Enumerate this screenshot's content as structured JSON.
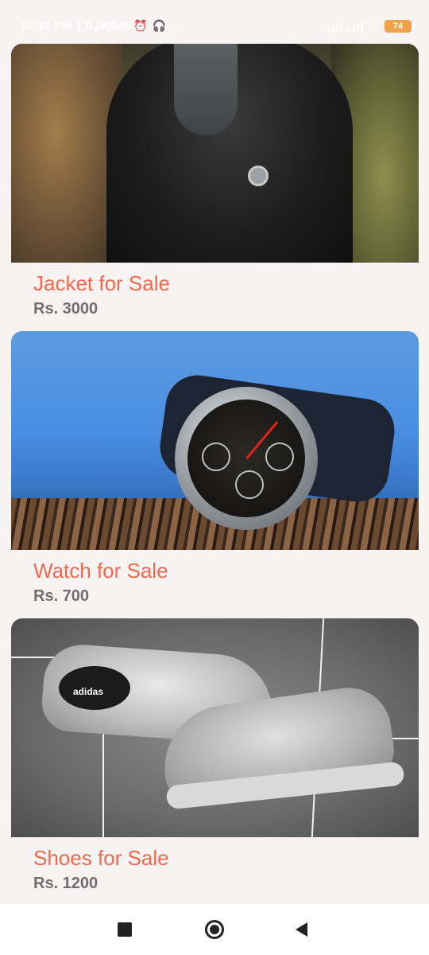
{
  "status_bar": {
    "time": "10:31 PM",
    "network_speed": "0.2KB/s",
    "battery": "74",
    "icons": [
      "alarm-icon",
      "headphones-icon",
      "more-icon",
      "signal-icon",
      "signal-icon",
      "wifi-icon",
      "battery-icon"
    ]
  },
  "items": [
    {
      "title": "Jacket for Sale",
      "price": "Rs. 3000",
      "image": "leather-jacket-photo"
    },
    {
      "title": "Watch for Sale",
      "price": "Rs. 700",
      "image": "wristwatch-photo"
    },
    {
      "title": "Shoes for Sale",
      "price": "Rs. 1200",
      "image": "sneakers-photo",
      "brand_text": "adidas"
    }
  ],
  "nav_bar": {
    "icons": [
      "recent-apps-icon",
      "home-icon",
      "back-icon"
    ]
  },
  "colors": {
    "background": "#f7f3f2",
    "title": "#ef6a4f",
    "price": "#6f6f6f",
    "battery": "#f0a24a"
  }
}
